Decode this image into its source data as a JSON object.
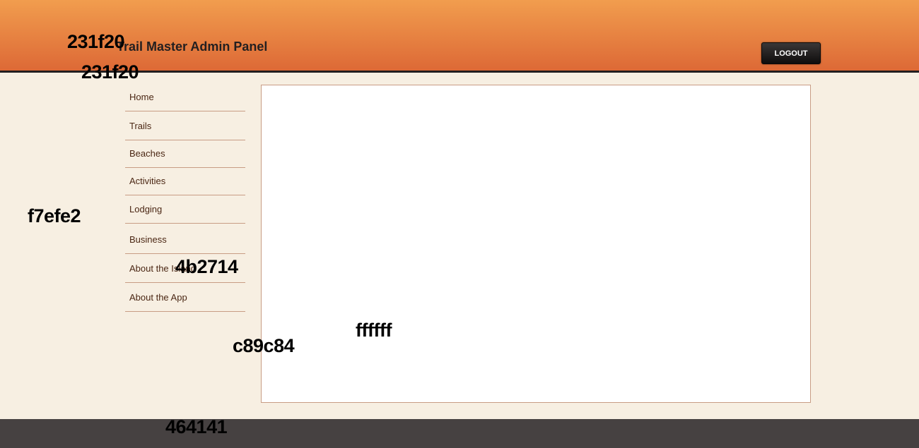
{
  "header": {
    "title": "Trail Master Admin Panel",
    "logout_label": "LOGOUT"
  },
  "nav": {
    "items": [
      {
        "label": "Home"
      },
      {
        "label": "Trails"
      },
      {
        "label": "Beaches"
      },
      {
        "label": "Activities"
      },
      {
        "label": "Lodging"
      },
      {
        "label": "Business"
      },
      {
        "label": "About the Island"
      },
      {
        "label": "About the App"
      }
    ]
  },
  "color_labels": {
    "header_text": "231f20",
    "header_border": "231f20",
    "page_background": "f7efe2",
    "nav_text": "4b2714",
    "content_background": "ffffff",
    "border": "c89c84",
    "footer": "464141"
  },
  "colors": {
    "header_top": "#f19d4e",
    "header_bottom": "#dd6936",
    "header_border": "#231f20",
    "page_background": "#f7efe2",
    "nav_text": "#4b2714",
    "border": "#c89c84",
    "content_background": "#ffffff",
    "footer": "#464141"
  }
}
